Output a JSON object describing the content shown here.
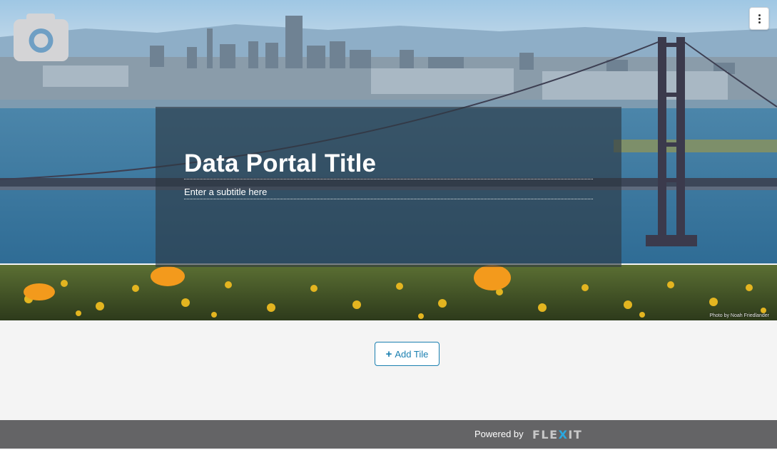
{
  "hero": {
    "title": "Data Portal Title",
    "subtitle": "Enter a subtitle here",
    "photo_credit": "Photo by Noah Friedlander",
    "camera_icon": "camera-icon",
    "menu_icon": "kebab-menu-icon"
  },
  "main": {
    "add_tile_label": "Add Tile",
    "add_tile_icon": "plus-icon",
    "accent_color": "#1a7fb0"
  },
  "footer": {
    "powered_by": "Powered by",
    "logo_text": {
      "part1": "FLE",
      "part2": "X",
      "part3": "IT"
    }
  }
}
